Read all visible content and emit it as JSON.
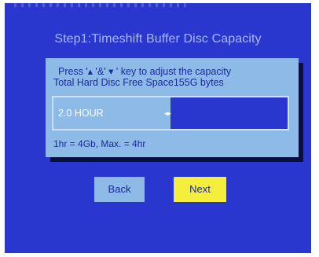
{
  "dialog": {
    "title": "Step1:Timeshift Buffer Disc Capacity",
    "instruction_line1": "Press '▴ '&' ▾ ' key to adjust the capacity",
    "instruction_line2": "Total Hard Disc Free Space155G bytes",
    "capacity_value": "2.0 HOUR",
    "capacity_fraction": 0.5,
    "marker_symbol": "◂▸",
    "note": "1hr = 4Gb, Max. = 4hr"
  },
  "buttons": {
    "back": "Back",
    "next": "Next"
  },
  "colors": {
    "screen_background": "#2a37ce",
    "panel": "#8ebae8",
    "title_text": "#a9b8ff",
    "highlight_button": "#f4ef3d"
  }
}
